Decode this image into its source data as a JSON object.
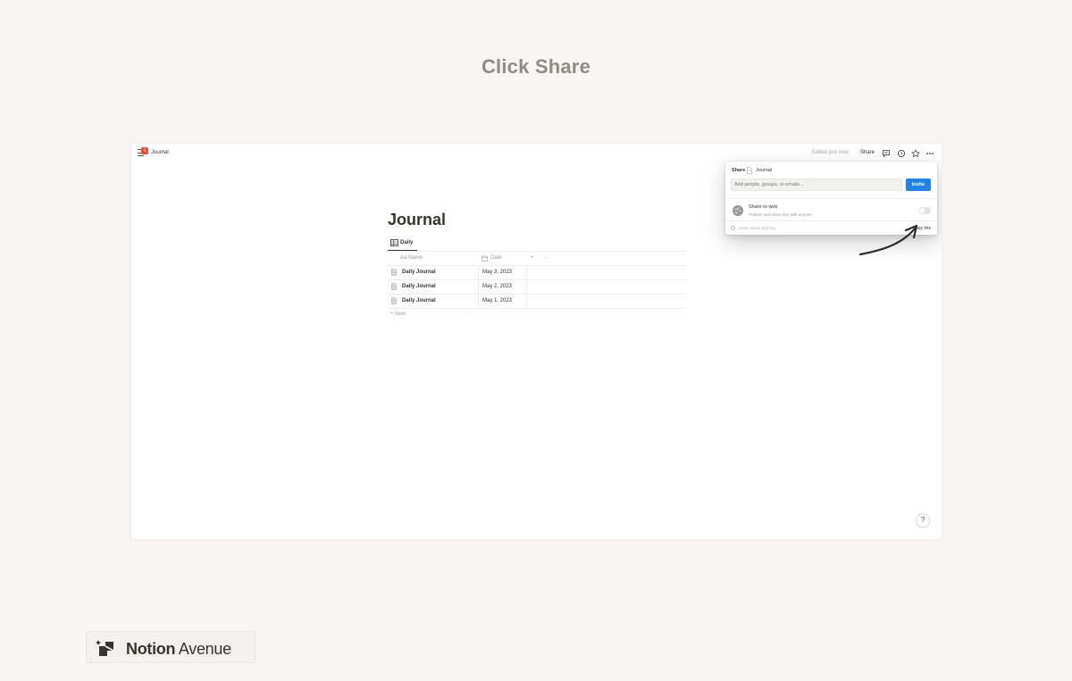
{
  "slide": {
    "title": "Click Share"
  },
  "topbar": {
    "breadcrumb": "Journal",
    "badge": "1",
    "edited": "Edited just now",
    "share_label": "Share"
  },
  "page": {
    "title": "Journal",
    "view_tab": "Daily",
    "columns": {
      "name": "Aa Name",
      "date": "Date",
      "add": "+",
      "more": "···"
    },
    "rows": [
      {
        "name": "Daily Journal",
        "date": "May 3, 2023"
      },
      {
        "name": "Daily Journal",
        "date": "May 2, 2023"
      },
      {
        "name": "Daily Journal",
        "date": "May 1, 2023"
      }
    ],
    "new_label": "+ New",
    "help": "?"
  },
  "share_popup": {
    "header": "Share",
    "page_name": "Journal",
    "input_placeholder": "Add people, groups, or emails...",
    "invite_label": "Invite",
    "web_title": "Share to web",
    "web_subtitle": "Publish and share link with anyone",
    "web_enabled": false,
    "learn_label": "Learn about sharing",
    "copy_link": "opy link"
  },
  "brand": {
    "name_bold": "Notion",
    "name_rest": " Avenue"
  },
  "colors": {
    "accent": "#2383e2",
    "background": "#f8f5f2",
    "badge": "#e04f40"
  }
}
